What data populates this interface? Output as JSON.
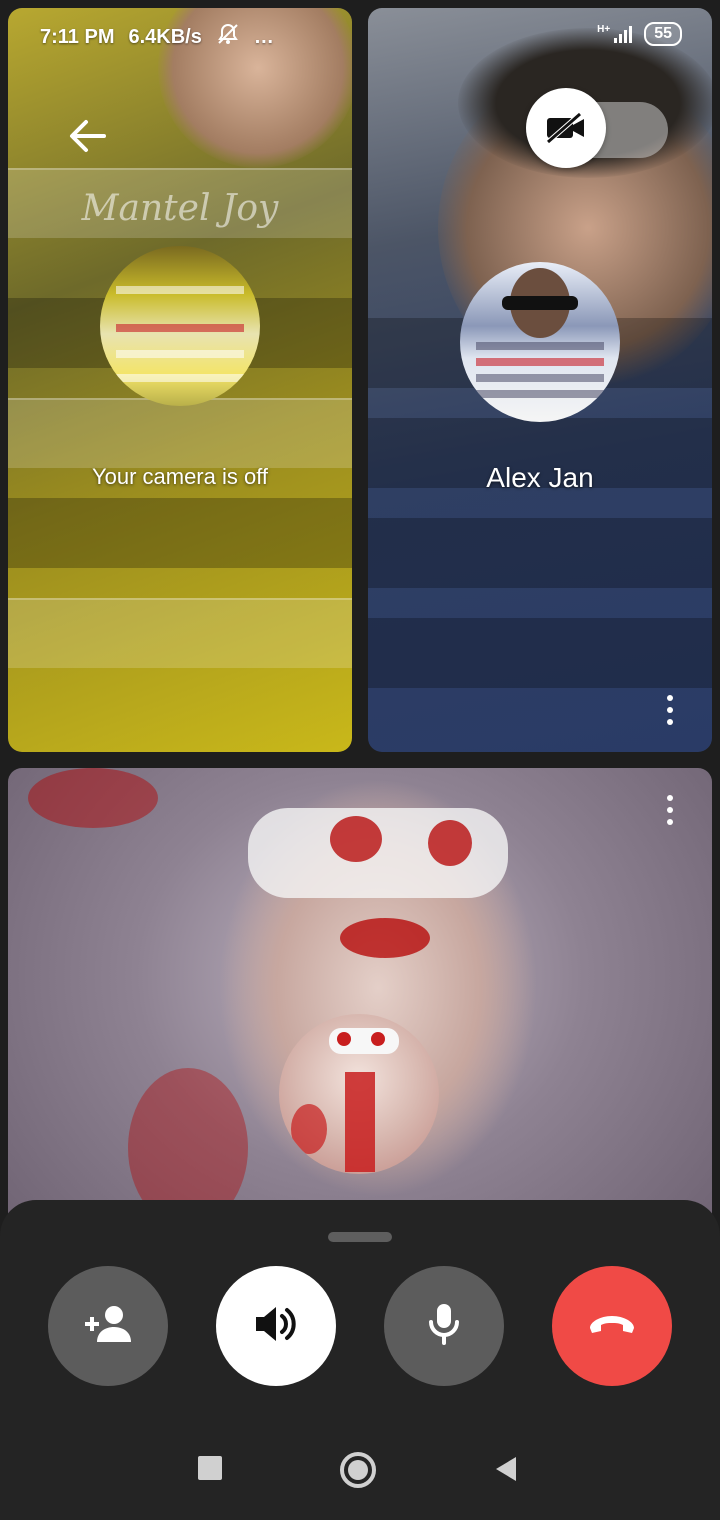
{
  "status_bar": {
    "time": "7:11 PM",
    "speed": "6.4KB/s",
    "overflow": "…",
    "network_type": "H+",
    "battery": "55",
    "icons": [
      "bell-off-icon",
      "signal-icon",
      "battery-icon"
    ]
  },
  "tiles": {
    "me": {
      "caption": "Your camera is off",
      "decor_banner": "Mantel Joy",
      "icons": [
        "back-arrow-icon"
      ]
    },
    "alex": {
      "name": "Alex Jan",
      "icons": [
        "video-off-icon",
        "more-vert-icon"
      ]
    },
    "third": {
      "icons": [
        "more-vert-icon"
      ]
    }
  },
  "controls": {
    "buttons": [
      {
        "name": "add-participant",
        "icon": "add-person-icon"
      },
      {
        "name": "speaker",
        "icon": "speaker-icon"
      },
      {
        "name": "microphone",
        "icon": "mic-icon"
      },
      {
        "name": "end-call",
        "icon": "hang-up-icon"
      }
    ]
  },
  "nav": {
    "buttons": [
      "recents-icon",
      "home-icon",
      "back-icon"
    ]
  },
  "colors": {
    "end_call": "#f04a46",
    "control_bg": "#5c5c5c",
    "sheet_bg": "#242424"
  }
}
